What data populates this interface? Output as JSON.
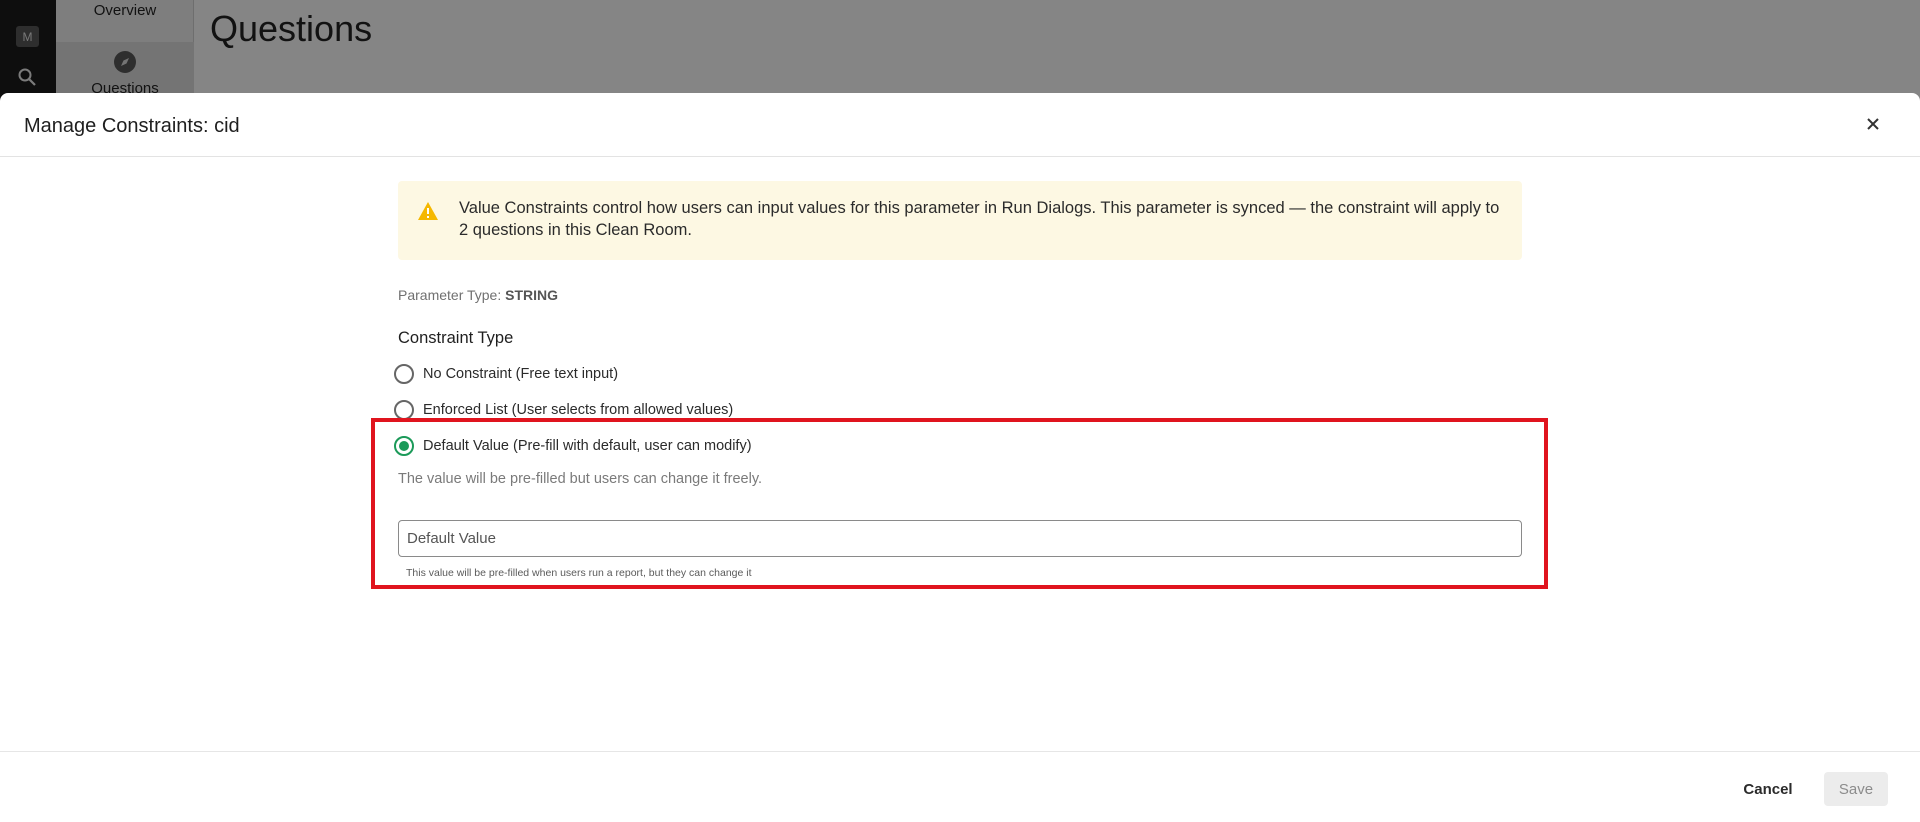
{
  "background": {
    "rail_badge": "M",
    "subnav": [
      {
        "label": "Overview",
        "icon": "overview-icon"
      },
      {
        "label": "Questions",
        "icon": "compass-icon"
      }
    ],
    "page_title": "Questions"
  },
  "dialog": {
    "title": "Manage Constraints: cid",
    "alert_text": "Value Constraints control how users can input values for this parameter in Run Dialogs. This parameter is synced — the constraint will apply to 2 questions in this Clean Room.",
    "param_type_label": "Parameter Type:",
    "param_type_value": "STRING",
    "constraint_type_title": "Constraint Type",
    "options": [
      {
        "label": "No Constraint (Free text input)",
        "checked": false
      },
      {
        "label": "Enforced List (User selects from allowed values)",
        "checked": false
      },
      {
        "label": "Default Value (Pre-fill with default, user can modify)",
        "checked": true
      }
    ],
    "selected_description": "The value will be pre-filled but users can change it freely.",
    "default_value_placeholder": "Default Value",
    "default_value_helper": "This value will be pre-filled when users run a report, but they can change it",
    "cancel_label": "Cancel",
    "save_label": "Save"
  },
  "colors": {
    "accent": "#1b9a59",
    "alert_bg": "#fdf8e3",
    "warning": "#f5b800",
    "highlight": "#e0141e"
  }
}
